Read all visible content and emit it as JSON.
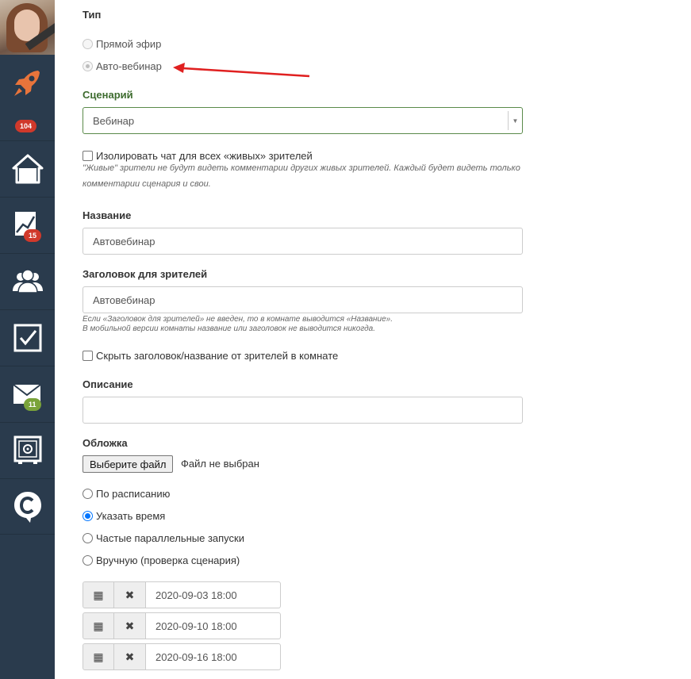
{
  "sidebar": {
    "items": [
      {
        "name": "rocket-icon"
      },
      {
        "name": "home-icon"
      },
      {
        "name": "chart-icon"
      },
      {
        "name": "users-icon"
      },
      {
        "name": "tasks-icon"
      },
      {
        "name": "mail-icon"
      },
      {
        "name": "safe-icon"
      },
      {
        "name": "chat-icon"
      }
    ],
    "badges": {
      "rocket": "104",
      "chart": "15",
      "mail": "11"
    },
    "colors": {
      "bg": "#2a3b4d",
      "accent": "#e8743b",
      "badge_red": "#d0392b",
      "badge_green": "#7aa33a"
    }
  },
  "form": {
    "type_label": "Тип",
    "type_options": [
      {
        "label": "Прямой эфир",
        "state": "disabled"
      },
      {
        "label": "Авто-вебинар",
        "state": "disabled-checked"
      }
    ],
    "scenario_label": "Сценарий",
    "scenario_value": "Вебинар",
    "isolate_chat_label": "Изолировать чат для всех «живых» зрителей",
    "isolate_chat_hint_1": "\"Живые\" зрители не будут видеть комментарии других живых зрителей. Каждый будет видеть только",
    "isolate_chat_hint_2": "комментарии сценария и свои.",
    "name_label": "Название",
    "name_value": "Автовебинар",
    "viewer_title_label": "Заголовок для зрителей",
    "viewer_title_value": "Автовебинар",
    "viewer_title_hint_1": "Если «Заголовок для зрителей» не введен, то в комнате выводится «Название».",
    "viewer_title_hint_2": "В мобильной версии комнаты название или заголовок не выводится никогда.",
    "hide_title_label": "Скрыть заголовок/название от зрителей в комнате",
    "description_label": "Описание",
    "description_value": "",
    "cover_label": "Обложка",
    "cover_button": "Выберите файл",
    "cover_status": "Файл не выбран",
    "schedule_options": [
      {
        "label": "По расписанию",
        "checked": false
      },
      {
        "label": "Указать время",
        "checked": true
      },
      {
        "label": "Частые параллельные запуски",
        "checked": false
      },
      {
        "label": "Вручную (проверка сценария)",
        "checked": false
      }
    ],
    "dates": [
      "2020-09-03 18:00",
      "2020-09-10 18:00",
      "2020-09-16 18:00"
    ]
  },
  "annotation": {
    "arrow_color": "#e02020"
  }
}
